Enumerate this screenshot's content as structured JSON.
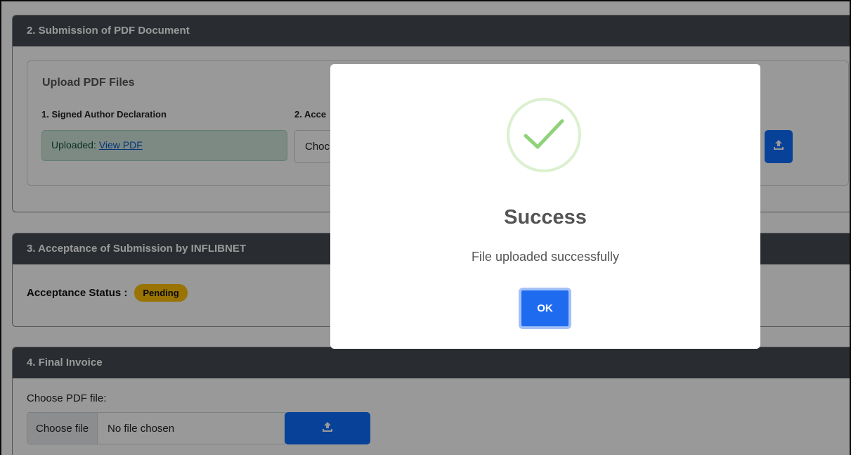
{
  "section2": {
    "header": "2. Submission of PDF Document",
    "upload_title": "Upload PDF Files",
    "field1_label": "1. Signed Author Declaration",
    "field2_label": "2. Acce",
    "uploaded_prefix": "Uploaded:",
    "view_pdf_link": "View PDF",
    "field2_value": "Choc"
  },
  "section3": {
    "header": "3. Acceptance of Submission by INFLIBNET",
    "status_label": "Acceptance Status :",
    "status_badge": "Pending"
  },
  "section4": {
    "header": "4. Final Invoice",
    "choose_label": "Choose PDF file:",
    "choose_button": "Choose file",
    "no_file_text": "No file chosen"
  },
  "modal": {
    "title": "Success",
    "message": "File uploaded successfully",
    "ok_label": "OK"
  },
  "colors": {
    "header_bg": "#454b52",
    "primary": "#0d6efd",
    "success_light": "#d1e7dd",
    "warning": "#ffc107",
    "check": "#8fd27a"
  },
  "icons": {
    "upload": "upload-icon",
    "success": "checkmark-icon"
  }
}
